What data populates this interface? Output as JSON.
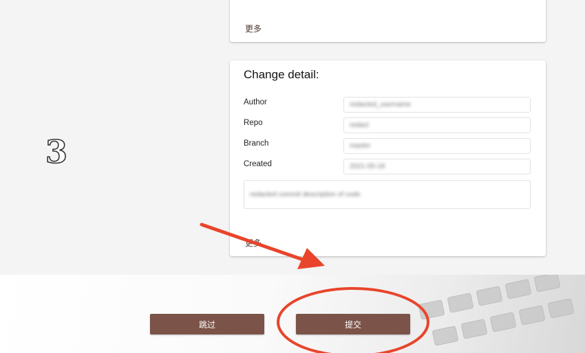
{
  "top_card": {
    "more_label": "更多"
  },
  "detail_card": {
    "title": "Change detail:",
    "fields": [
      {
        "label": "Author",
        "value": "redacted_username"
      },
      {
        "label": "Repo",
        "value": "redact"
      },
      {
        "label": "Branch",
        "value": "master"
      },
      {
        "label": "Created",
        "value": "2021-05-18"
      }
    ],
    "comment_value": "redacted commit description of code",
    "more_label": "更多"
  },
  "step": {
    "number": "3"
  },
  "actions": {
    "skip_label": "跳过",
    "submit_label": "提交"
  },
  "colors": {
    "button": "#7b5348",
    "annotation": "#e8452c"
  }
}
